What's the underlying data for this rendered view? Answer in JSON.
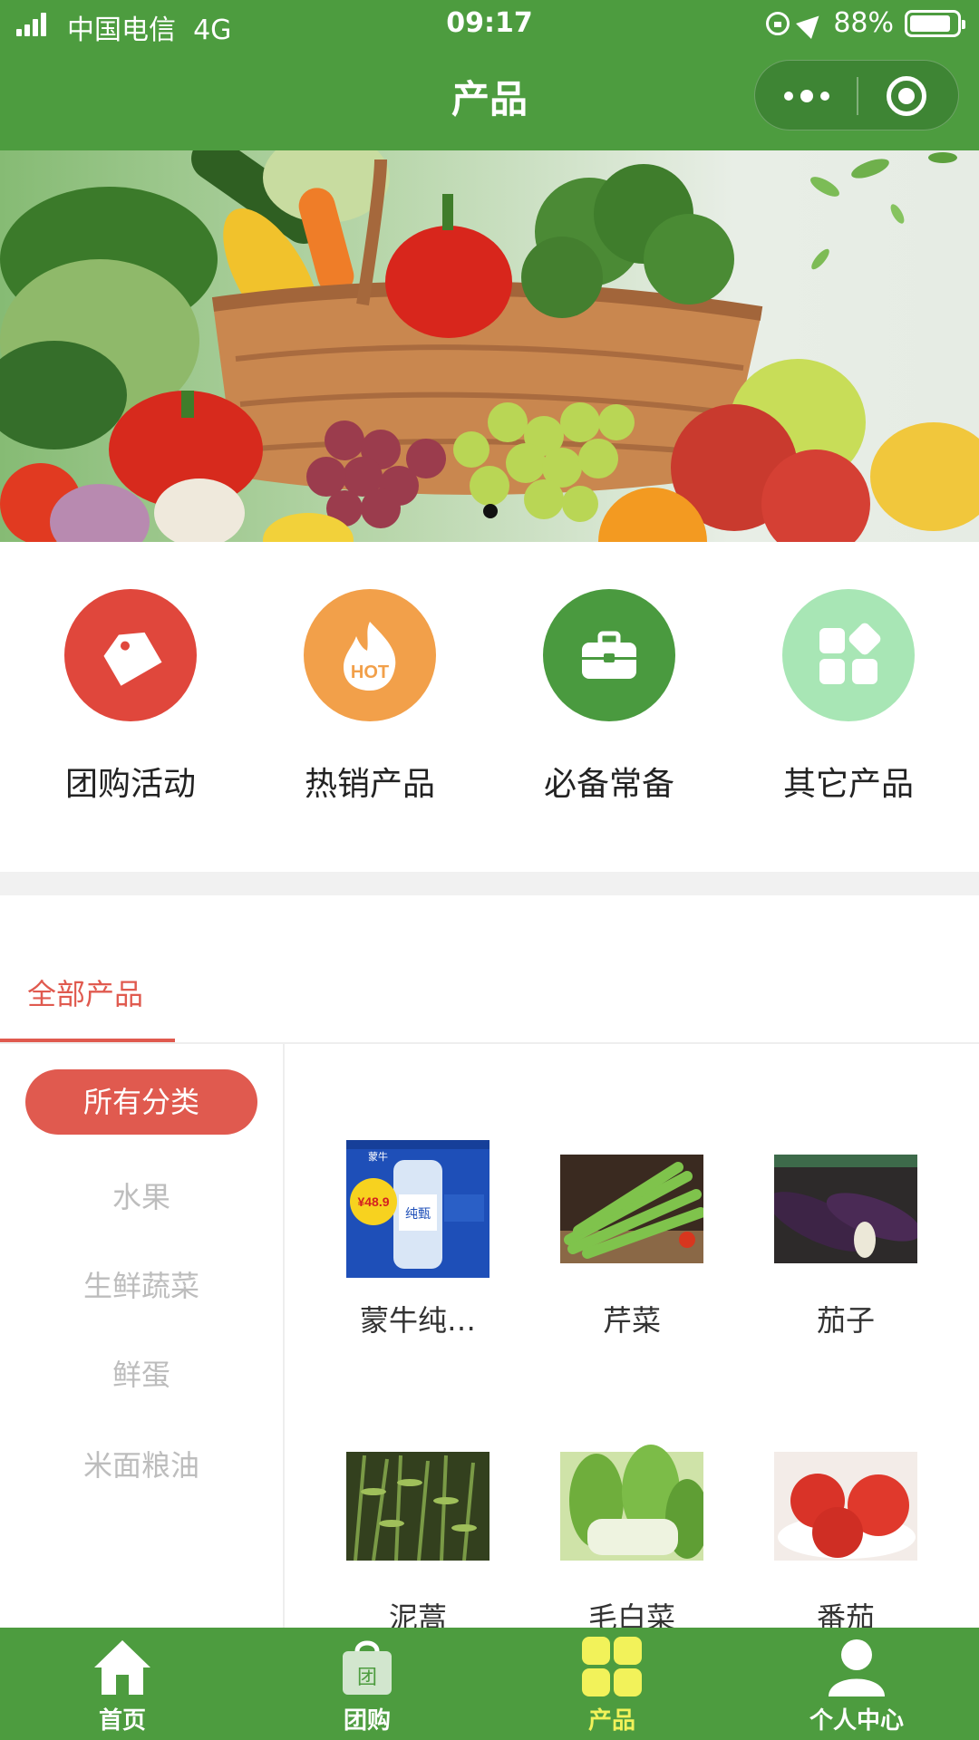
{
  "status_bar": {
    "carrier": "中国电信",
    "network": "4G",
    "time": "09:17",
    "battery": "88%",
    "battery_level": 0.88
  },
  "header": {
    "title": "产品",
    "more_icon": "more-dots-icon",
    "close_icon": "close-target-icon"
  },
  "banner": {
    "image": "vegetable-basket",
    "page_count": 1,
    "active_index": 0
  },
  "categories": [
    {
      "label": "团购活动",
      "color": "#e0473c",
      "icon": "price-tag-icon"
    },
    {
      "label": "热销产品",
      "color": "#f2a04a",
      "icon": "hot-flame-icon"
    },
    {
      "label": "必备常备",
      "color": "#4a9a3f",
      "icon": "toolbox-icon"
    },
    {
      "label": "其它产品",
      "color": "#a8e6b5",
      "icon": "grid-squares-icon"
    }
  ],
  "product_tabs": {
    "active": "全部产品"
  },
  "sidebar": {
    "items": [
      {
        "label": "所有分类"
      },
      {
        "label": "水果"
      },
      {
        "label": "生鲜蔬菜"
      },
      {
        "label": "鲜蛋"
      },
      {
        "label": "米面粮油"
      }
    ]
  },
  "products": [
    {
      "name": "蒙牛纯…",
      "price_tag": "¥48.9",
      "brand": "蒙牛",
      "pack_text": "纯甄"
    },
    {
      "name": "芹菜"
    },
    {
      "name": "茄子"
    },
    {
      "name": "泥蒿"
    },
    {
      "name": "毛白菜"
    },
    {
      "name": "番茄"
    }
  ],
  "tabbar": {
    "items": [
      {
        "label": "首页",
        "icon": "home-icon"
      },
      {
        "label": "团购",
        "icon": "shopping-bag-icon",
        "bag_text": "团"
      },
      {
        "label": "产品",
        "icon": "product-grid-icon"
      },
      {
        "label": "个人中心",
        "icon": "user-icon"
      }
    ],
    "active": "产品"
  },
  "colors": {
    "brand": "#4d9c3f",
    "accent": "#e05a4f",
    "tab_active": "#f2f25a"
  }
}
